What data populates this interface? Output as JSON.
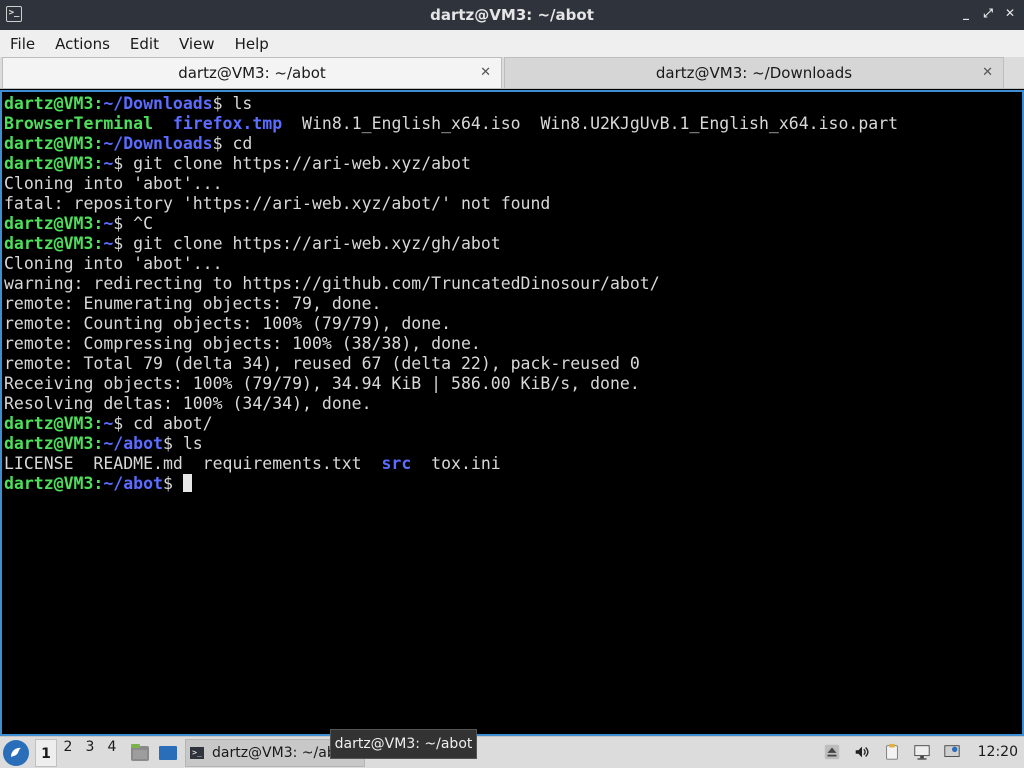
{
  "window": {
    "title": "dartz@VM3: ~/abot",
    "controls": [
      "_",
      "⤢",
      "✕"
    ]
  },
  "menubar": {
    "items": [
      "File",
      "Actions",
      "Edit",
      "View",
      "Help"
    ]
  },
  "tabs": [
    {
      "label": "dartz@VM3: ~/abot",
      "active": true
    },
    {
      "label": "dartz@VM3: ~/Downloads",
      "active": false
    }
  ],
  "terminal": {
    "user": "dartz@VM3",
    "lines": [
      {
        "type": "prompt",
        "path": "~/Downloads",
        "cmd": " ls"
      },
      {
        "type": "ls1",
        "items": [
          {
            "text": "BrowserTerminal",
            "kind": "exec"
          },
          {
            "text": "  ",
            "kind": "plain"
          },
          {
            "text": "firefox.tmp",
            "kind": "dir"
          },
          {
            "text": "  Win8.1_English_x64.iso  Win8.U2KJgUvB.1_English_x64.iso.part",
            "kind": "plain"
          }
        ]
      },
      {
        "type": "prompt",
        "path": "~/Downloads",
        "cmd": " cd"
      },
      {
        "type": "prompt",
        "path": "~",
        "cmd": " git clone https://ari-web.xyz/abot"
      },
      {
        "type": "out",
        "text": "Cloning into 'abot'..."
      },
      {
        "type": "out",
        "text": "fatal: repository 'https://ari-web.xyz/abot/' not found"
      },
      {
        "type": "prompt",
        "path": "~",
        "cmd": " ^C"
      },
      {
        "type": "prompt",
        "path": "~",
        "cmd": " git clone https://ari-web.xyz/gh/abot"
      },
      {
        "type": "out",
        "text": "Cloning into 'abot'..."
      },
      {
        "type": "out",
        "text": "warning: redirecting to https://github.com/TruncatedDinosour/abot/"
      },
      {
        "type": "out",
        "text": "remote: Enumerating objects: 79, done."
      },
      {
        "type": "out",
        "text": "remote: Counting objects: 100% (79/79), done."
      },
      {
        "type": "out",
        "text": "remote: Compressing objects: 100% (38/38), done."
      },
      {
        "type": "out",
        "text": "remote: Total 79 (delta 34), reused 67 (delta 22), pack-reused 0"
      },
      {
        "type": "out",
        "text": "Receiving objects: 100% (79/79), 34.94 KiB | 586.00 KiB/s, done."
      },
      {
        "type": "out",
        "text": "Resolving deltas: 100% (34/34), done."
      },
      {
        "type": "prompt",
        "path": "~",
        "cmd": " cd abot/"
      },
      {
        "type": "prompt",
        "path": "~/abot",
        "cmd": " ls"
      },
      {
        "type": "ls1",
        "items": [
          {
            "text": "LICENSE  README.md  requirements.txt  ",
            "kind": "plain"
          },
          {
            "text": "src",
            "kind": "dir"
          },
          {
            "text": "  tox.ini",
            "kind": "plain"
          }
        ]
      },
      {
        "type": "prompt",
        "path": "~/abot",
        "cmd": " ",
        "cursor": true
      }
    ]
  },
  "taskbar": {
    "workspaces": [
      "1",
      "2",
      "3",
      "4"
    ],
    "active_workspace": "1",
    "task_label": "dartz@VM3: ~/abot",
    "tooltip": "dartz@VM3: ~/abot",
    "clock": "12:20"
  },
  "colors": {
    "user": "#4ee05a",
    "path": "#5c6cff",
    "text": "#d8d8d8",
    "focus_border": "#3d8fd1"
  }
}
